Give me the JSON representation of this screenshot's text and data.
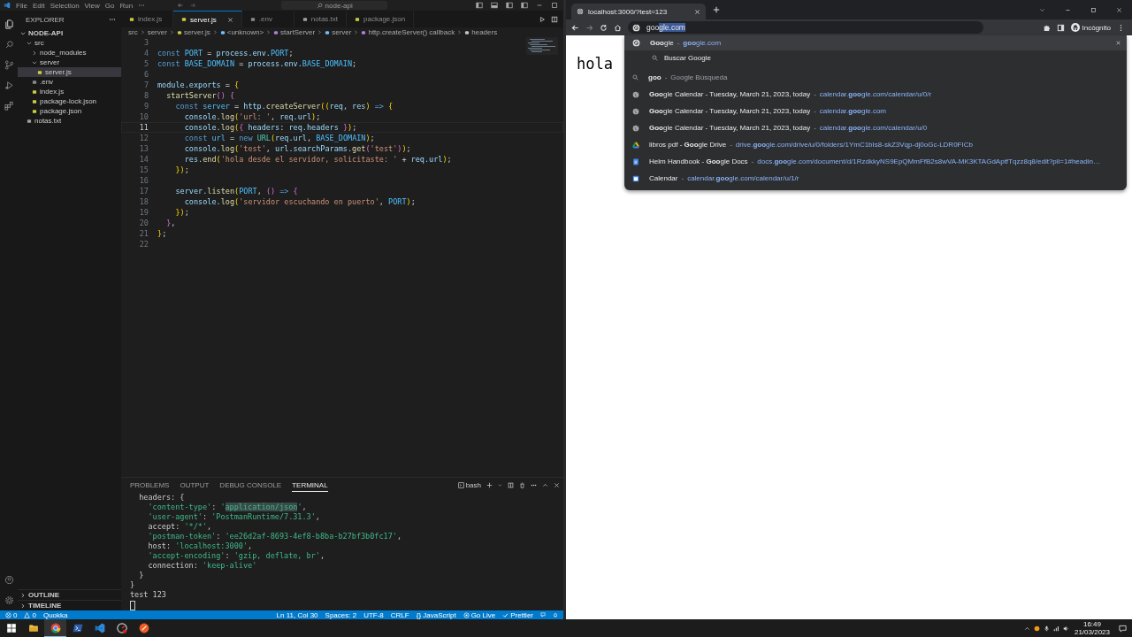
{
  "vscode": {
    "menu": [
      "File",
      "Edit",
      "Selection",
      "View",
      "Go",
      "Run"
    ],
    "command_center": "node-api",
    "explorer": {
      "title": "EXPLORER",
      "root": {
        "name": "NODE-API",
        "expanded": true
      },
      "tree": [
        {
          "name": "src",
          "kind": "folder",
          "expanded": true,
          "selected": false,
          "children": [
            {
              "name": "node_modules",
              "kind": "folder",
              "expanded": false,
              "selected": false
            },
            {
              "name": "server",
              "kind": "folder",
              "expanded": true,
              "selected": false,
              "children": [
                {
                  "name": "server.js",
                  "kind": "js",
                  "selected": true
                }
              ]
            },
            {
              "name": ".env",
              "kind": "env",
              "selected": false
            },
            {
              "name": "index.js",
              "kind": "js",
              "selected": false
            },
            {
              "name": "package-lock.json",
              "kind": "json",
              "selected": false
            },
            {
              "name": "package.json",
              "kind": "json",
              "selected": false
            }
          ]
        },
        {
          "name": "notas.txt",
          "kind": "txt",
          "selected": false
        }
      ],
      "sections": [
        {
          "label": "OUTLINE",
          "expanded": false
        },
        {
          "label": "TIMELINE",
          "expanded": false
        }
      ]
    },
    "tabs": [
      {
        "label": "index.js",
        "kind": "js",
        "selected": false
      },
      {
        "label": "server.js",
        "kind": "js",
        "selected": true
      },
      {
        "label": ".env",
        "kind": "env",
        "selected": false
      },
      {
        "label": "notas.txt",
        "kind": "txt",
        "selected": false
      },
      {
        "label": "package.json",
        "kind": "json",
        "selected": false
      }
    ],
    "breadcrumb": [
      {
        "label": "src",
        "kind": "folder"
      },
      {
        "label": "server",
        "kind": "folder"
      },
      {
        "label": "server.js",
        "kind": "js"
      },
      {
        "label": "<unknown>",
        "kind": "variable"
      },
      {
        "label": "startServer",
        "kind": "method"
      },
      {
        "label": "server",
        "kind": "variable"
      },
      {
        "label": "http.createServer() callback",
        "kind": "method"
      },
      {
        "label": "headers",
        "kind": "property"
      }
    ],
    "code": [
      {
        "number": "3",
        "current": false
      },
      {
        "number": "4",
        "current": false,
        "tokens": [
          {
            "text": "const ",
            "kind": "kw"
          },
          {
            "text": "PORT",
            "kind": "const"
          },
          {
            "text": " = ",
            "kind": "punc"
          },
          {
            "text": "process.env.",
            "kind": "var"
          },
          {
            "text": "PORT",
            "kind": "const"
          },
          {
            "text": ";",
            "kind": "punc"
          }
        ]
      },
      {
        "number": "5",
        "current": false,
        "tokens": [
          {
            "text": "const ",
            "kind": "kw"
          },
          {
            "text": "BASE_DOMAIN",
            "kind": "const"
          },
          {
            "text": " = ",
            "kind": "punc"
          },
          {
            "text": "process.env.",
            "kind": "var"
          },
          {
            "text": "BASE_DOMAIN",
            "kind": "const"
          },
          {
            "text": ";",
            "kind": "punc"
          }
        ]
      },
      {
        "number": "6",
        "current": false
      },
      {
        "number": "7",
        "current": false,
        "tokens": [
          {
            "text": "module.exports",
            "kind": "var"
          },
          {
            "text": " = ",
            "kind": "punc"
          },
          {
            "text": "{",
            "kind": "brace"
          }
        ]
      },
      {
        "number": "8",
        "current": false,
        "tokens": [
          {
            "text": "  startServer",
            "kind": "fn"
          },
          {
            "text": "() {",
            "kind": "brace2"
          }
        ]
      },
      {
        "number": "9",
        "current": false,
        "tokens": [
          {
            "text": "    const ",
            "kind": "kw"
          },
          {
            "text": "server",
            "kind": "const"
          },
          {
            "text": " = ",
            "kind": "punc"
          },
          {
            "text": "http.",
            "kind": "var"
          },
          {
            "text": "createServer",
            "kind": "fn"
          },
          {
            "text": "((",
            "kind": "brace"
          },
          {
            "text": "req, res",
            "kind": "var"
          },
          {
            "text": ")",
            "kind": "brace"
          },
          {
            "text": " => ",
            "kind": "kw"
          },
          {
            "text": "{",
            "kind": "brace"
          }
        ]
      },
      {
        "number": "10",
        "current": false,
        "tokens": [
          {
            "text": "      console.",
            "kind": "var"
          },
          {
            "text": "log",
            "kind": "fn"
          },
          {
            "text": "(",
            "kind": "brace"
          },
          {
            "text": "'url: '",
            "kind": "str"
          },
          {
            "text": ", ",
            "kind": "punc"
          },
          {
            "text": "req.url",
            "kind": "var"
          },
          {
            "text": ")",
            "kind": "brace"
          },
          {
            "text": ";",
            "kind": "punc"
          }
        ]
      },
      {
        "number": "11",
        "current": true,
        "tokens": [
          {
            "text": "      console.",
            "kind": "var"
          },
          {
            "text": "log",
            "kind": "fn"
          },
          {
            "text": "(",
            "kind": "brace"
          },
          {
            "text": "{",
            "kind": "brace2"
          },
          {
            "text": " headers",
            "kind": "var"
          },
          {
            "text": ": ",
            "kind": "punc"
          },
          {
            "text": "req.headers",
            "kind": "var"
          },
          {
            "text": " }",
            "kind": "brace2"
          },
          {
            "text": ")",
            "kind": "brace"
          },
          {
            "text": ";",
            "kind": "punc"
          }
        ]
      },
      {
        "number": "12",
        "current": false,
        "tokens": [
          {
            "text": "      const ",
            "kind": "kw"
          },
          {
            "text": "url",
            "kind": "const"
          },
          {
            "text": " = ",
            "kind": "punc"
          },
          {
            "text": "new ",
            "kind": "kw"
          },
          {
            "text": "URL",
            "kind": "type"
          },
          {
            "text": "(",
            "kind": "brace"
          },
          {
            "text": "req.url",
            "kind": "var"
          },
          {
            "text": ", ",
            "kind": "punc"
          },
          {
            "text": "BASE_DOMAIN",
            "kind": "const"
          },
          {
            "text": ")",
            "kind": "brace"
          },
          {
            "text": ";",
            "kind": "punc"
          }
        ]
      },
      {
        "number": "13",
        "current": false,
        "tokens": [
          {
            "text": "      console.",
            "kind": "var"
          },
          {
            "text": "log",
            "kind": "fn"
          },
          {
            "text": "(",
            "kind": "brace"
          },
          {
            "text": "'test'",
            "kind": "str"
          },
          {
            "text": ", ",
            "kind": "punc"
          },
          {
            "text": "url.searchParams.",
            "kind": "var"
          },
          {
            "text": "get",
            "kind": "fn"
          },
          {
            "text": "(",
            "kind": "brace2"
          },
          {
            "text": "'test'",
            "kind": "str"
          },
          {
            "text": ")",
            "kind": "brace2"
          },
          {
            "text": ")",
            "kind": "brace"
          },
          {
            "text": ";",
            "kind": "punc"
          }
        ]
      },
      {
        "number": "14",
        "current": false,
        "tokens": [
          {
            "text": "      res.",
            "kind": "var"
          },
          {
            "text": "end",
            "kind": "fn"
          },
          {
            "text": "(",
            "kind": "brace"
          },
          {
            "text": "'hola desde el servidor, solicitaste: '",
            "kind": "str"
          },
          {
            "text": " + ",
            "kind": "punc"
          },
          {
            "text": "req.url",
            "kind": "var"
          },
          {
            "text": ")",
            "kind": "brace"
          },
          {
            "text": ";",
            "kind": "punc"
          }
        ]
      },
      {
        "number": "15",
        "current": false,
        "tokens": [
          {
            "text": "    })",
            "kind": "brace"
          },
          {
            "text": ";",
            "kind": "punc"
          }
        ]
      },
      {
        "number": "16",
        "current": false
      },
      {
        "number": "17",
        "current": false,
        "tokens": [
          {
            "text": "    server.",
            "kind": "var"
          },
          {
            "text": "listen",
            "kind": "fn"
          },
          {
            "text": "(",
            "kind": "brace"
          },
          {
            "text": "PORT",
            "kind": "const"
          },
          {
            "text": ", ",
            "kind": "punc"
          },
          {
            "text": "()",
            "kind": "brace2"
          },
          {
            "text": " => ",
            "kind": "kw"
          },
          {
            "text": "{",
            "kind": "brace2"
          }
        ]
      },
      {
        "number": "18",
        "current": false,
        "tokens": [
          {
            "text": "      console.",
            "kind": "var"
          },
          {
            "text": "log",
            "kind": "fn"
          },
          {
            "text": "(",
            "kind": "brace"
          },
          {
            "text": "'servidor escuchando en puerto'",
            "kind": "str"
          },
          {
            "text": ", ",
            "kind": "punc"
          },
          {
            "text": "PORT",
            "kind": "const"
          },
          {
            "text": ")",
            "kind": "brace"
          },
          {
            "text": ";",
            "kind": "punc"
          }
        ]
      },
      {
        "number": "19",
        "current": false,
        "tokens": [
          {
            "text": "    })",
            "kind": "brace"
          },
          {
            "text": ";",
            "kind": "punc"
          }
        ]
      },
      {
        "number": "20",
        "current": false,
        "tokens": [
          {
            "text": "  }",
            "kind": "brace2"
          },
          {
            "text": ",",
            "kind": "punc"
          }
        ]
      },
      {
        "number": "21",
        "current": false,
        "tokens": [
          {
            "text": "}",
            "kind": "brace"
          },
          {
            "text": ";",
            "kind": "punc"
          }
        ]
      },
      {
        "number": "22",
        "current": false
      }
    ],
    "panel_tabs": [
      {
        "label": "PROBLEMS",
        "selected": false
      },
      {
        "label": "OUTPUT",
        "selected": false
      },
      {
        "label": "DEBUG CONSOLE",
        "selected": false
      },
      {
        "label": "TERMINAL",
        "selected": true
      }
    ],
    "shell": "bash",
    "terminal": [
      [
        {
          "text": "  headers: {",
          "kind": "plain"
        }
      ],
      [
        {
          "text": "    'content-type'",
          "kind": "str"
        },
        {
          "text": ": ",
          "kind": "plain"
        },
        {
          "text": "'",
          "kind": "str"
        },
        {
          "text": "application/json",
          "kind": "sel"
        },
        {
          "text": "'",
          "kind": "str"
        },
        {
          "text": ",",
          "kind": "plain"
        }
      ],
      [
        {
          "text": "    'user-agent'",
          "kind": "str"
        },
        {
          "text": ": ",
          "kind": "plain"
        },
        {
          "text": "'PostmanRuntime/7.31.3'",
          "kind": "str"
        },
        {
          "text": ",",
          "kind": "plain"
        }
      ],
      [
        {
          "text": "    accept: ",
          "kind": "plain"
        },
        {
          "text": "'*/*'",
          "kind": "str"
        },
        {
          "text": ",",
          "kind": "plain"
        }
      ],
      [
        {
          "text": "    'postman-token'",
          "kind": "str"
        },
        {
          "text": ": ",
          "kind": "plain"
        },
        {
          "text": "'ee26d2af-8693-4ef8-b8ba-b27bf3b0fc17'",
          "kind": "str"
        },
        {
          "text": ",",
          "kind": "plain"
        }
      ],
      [
        {
          "text": "    host: ",
          "kind": "plain"
        },
        {
          "text": "'localhost:3000'",
          "kind": "str"
        },
        {
          "text": ",",
          "kind": "plain"
        }
      ],
      [
        {
          "text": "    'accept-encoding'",
          "kind": "str"
        },
        {
          "text": ": ",
          "kind": "plain"
        },
        {
          "text": "'gzip, deflate, br'",
          "kind": "str"
        },
        {
          "text": ",",
          "kind": "plain"
        }
      ],
      [
        {
          "text": "    connection: ",
          "kind": "plain"
        },
        {
          "text": "'keep-alive'",
          "kind": "str"
        }
      ],
      [
        {
          "text": "  }",
          "kind": "plain"
        }
      ],
      [
        {
          "text": "}",
          "kind": "plain"
        }
      ],
      [
        {
          "text": "test 123",
          "kind": "plain"
        }
      ]
    ],
    "status_left": [
      {
        "kind": "errors",
        "text": "0"
      },
      {
        "kind": "warnings",
        "text": "0"
      },
      {
        "kind": "plain",
        "text": "Quokka"
      }
    ],
    "status_right": [
      {
        "kind": "plain",
        "text": "Ln 11, Col 30"
      },
      {
        "kind": "plain",
        "text": "Spaces: 2"
      },
      {
        "kind": "plain",
        "text": "UTF-8"
      },
      {
        "kind": "plain",
        "text": "CRLF"
      },
      {
        "kind": "plain",
        "text": "{} JavaScript"
      },
      {
        "kind": "live",
        "text": "Go Live"
      },
      {
        "kind": "prettier",
        "text": "Prettier"
      }
    ]
  },
  "chrome": {
    "tab": {
      "title": "localhost:3000/?test=123"
    },
    "omnibox": {
      "typed": "goo",
      "completion": "gle.com"
    },
    "profile": "Incógnito",
    "page_text": "hola",
    "suggestions": [
      {
        "kind": "google",
        "title": "**Goo**gle",
        "sep": "-",
        "url": "**goo**gle.com",
        "selected": true
      },
      {
        "kind": "action",
        "title": "Buscar Google",
        "selected": false
      },
      {
        "kind": "search",
        "title": "**goo**",
        "sep": "-",
        "url": "Google Búsqueda",
        "selected": false
      },
      {
        "kind": "globe",
        "title": "**Goo**gle Calendar - Tuesday, March 21, 2023, today",
        "sep": "-",
        "url": "calendar.**goo**gle.com/calendar/u/0/r",
        "selected": false
      },
      {
        "kind": "globe",
        "title": "**Goo**gle Calendar - Tuesday, March 21, 2023, today",
        "sep": "-",
        "url": "calendar.**goo**gle.com",
        "selected": false
      },
      {
        "kind": "globe",
        "title": "**Goo**gle Calendar - Tuesday, March 21, 2023, today",
        "sep": "-",
        "url": "calendar.**goo**gle.com/calendar/u/0",
        "selected": false
      },
      {
        "kind": "drive",
        "title": "libros pdf - **Goo**gle Drive",
        "sep": "-",
        "url": "drive.**goo**gle.com/drive/u/0/folders/1YmC1bIs8-skZ3Vqp-dj0oGc-LDR0FICb",
        "selected": false
      },
      {
        "kind": "docs",
        "title": "Helm Handbook - **Goo**gle Docs",
        "sep": "-",
        "url": "docs.**goo**gle.com/document/d/1RzdkkyNS9EpQMmFfB2s8wVA-MK3KTAGdAptfTqzz8q8/edit?pli=1#headin…",
        "selected": false
      },
      {
        "kind": "calendar",
        "title": "Calendar",
        "sep": "-",
        "url": "calendar.**goo**gle.com/calendar/u/1/r",
        "selected": false
      }
    ]
  },
  "taskbar": {
    "apps": [
      {
        "kind": "start",
        "active": false
      },
      {
        "kind": "folder",
        "active": false
      },
      {
        "kind": "chrome",
        "active": true
      },
      {
        "kind": "powershell",
        "active": false
      },
      {
        "kind": "vscode",
        "active": false
      },
      {
        "kind": "gauge",
        "active": false
      },
      {
        "kind": "orange",
        "active": false
      }
    ],
    "time": "16:49",
    "date": "21/03/2023"
  }
}
